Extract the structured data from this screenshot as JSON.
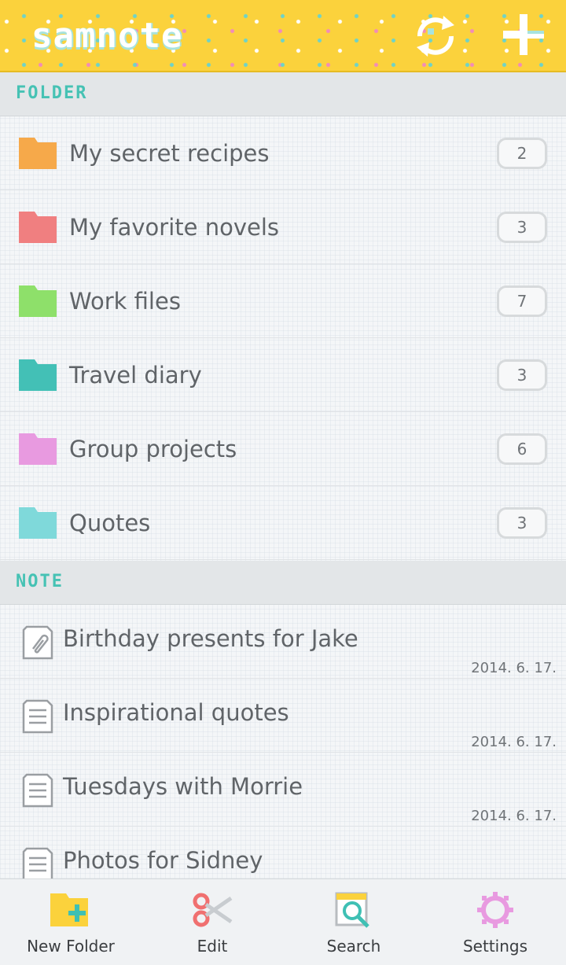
{
  "header": {
    "app_title": "samnote",
    "sync_icon": "sync-icon",
    "add_icon": "add-icon",
    "brand_color": "#fbd23c"
  },
  "folder_section": {
    "label": "FOLDER",
    "folders": [
      {
        "name": "My secret recipes",
        "count": "2",
        "color": "#f6a94a"
      },
      {
        "name": "My favorite novels",
        "count": "3",
        "color": "#f07f80"
      },
      {
        "name": "Work files",
        "count": "7",
        "color": "#8ee06a"
      },
      {
        "name": "Travel diary",
        "count": "3",
        "color": "#43c0b6"
      },
      {
        "name": "Group projects",
        "count": "6",
        "color": "#e89ae0"
      },
      {
        "name": "Quotes",
        "count": "3",
        "color": "#7fd9da"
      }
    ]
  },
  "note_section": {
    "label": "NOTE",
    "notes": [
      {
        "title": "Birthday presents for Jake",
        "date": "2014. 6. 17.",
        "icon": "attachment-note-icon"
      },
      {
        "title": "Inspirational quotes",
        "date": "2014. 6. 17.",
        "icon": "note-icon"
      },
      {
        "title": "Tuesdays with Morrie",
        "date": "2014. 6. 17.",
        "icon": "note-icon"
      },
      {
        "title": "Photos for Sidney",
        "date": "",
        "icon": "note-icon"
      }
    ]
  },
  "bottom_bar": {
    "new_folder": "New Folder",
    "edit": "Edit",
    "search": "Search",
    "settings": "Settings"
  }
}
